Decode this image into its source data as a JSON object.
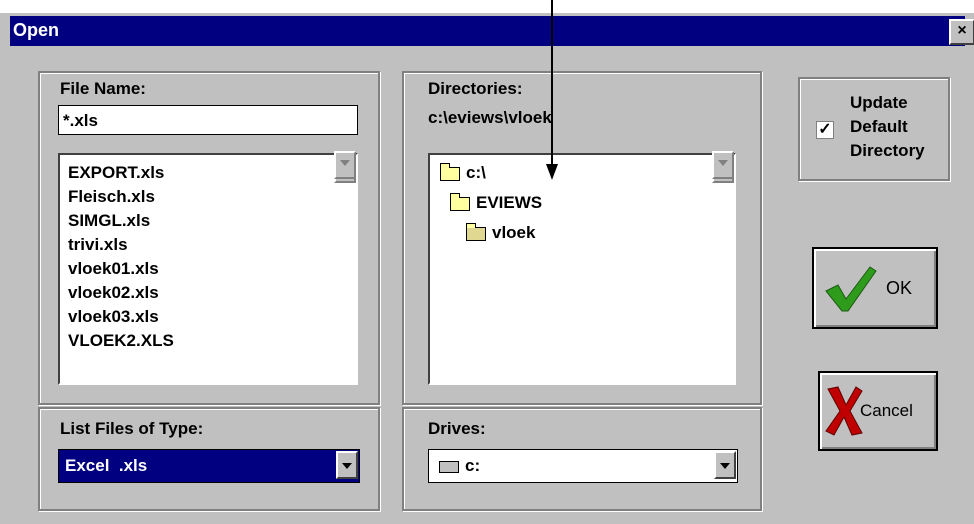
{
  "window": {
    "title": "Open",
    "close_label": "×"
  },
  "file_name": {
    "label": "File Name:",
    "value": "*.xls",
    "files": [
      "EXPORT.xls",
      "Fleisch.xls",
      "SIMGL.xls",
      "trivi.xls",
      "vloek01.xls",
      "vloek02.xls",
      "vloek03.xls",
      "VLOEK2.XLS"
    ]
  },
  "directories": {
    "label": "Directories:",
    "path": "c:\\eviews\\vloek",
    "tree": [
      "c:\\",
      "EVIEWS",
      "vloek"
    ]
  },
  "update_default": {
    "label_line1": "Update",
    "label_line2": "Default",
    "label_line3": "Directory",
    "checked_mark": "✓"
  },
  "ok_button": {
    "label": "OK"
  },
  "cancel_button": {
    "label": "Cancel"
  },
  "list_type": {
    "label": "List Files of Type:",
    "value": "Excel  .xls"
  },
  "drives": {
    "label": "Drives:",
    "value": "c:"
  },
  "colors": {
    "titlebar": "#000080",
    "face": "#c0c0c0",
    "selection": "#000080",
    "check_green": "#2e9b1c",
    "cancel_red": "#c00000"
  }
}
